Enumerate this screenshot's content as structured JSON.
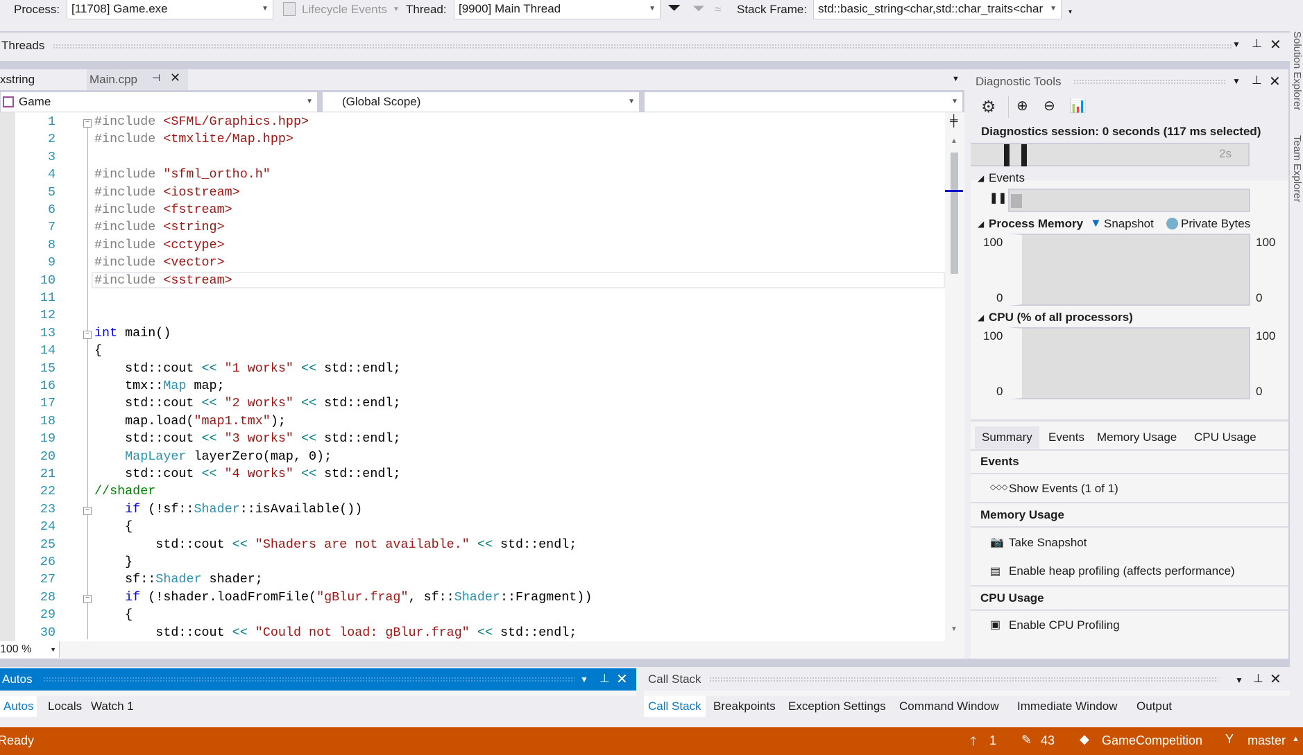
{
  "toolbar": {
    "process_label": "Process:",
    "process_value": "[11708] Game.exe",
    "lifecycle_label": "Lifecycle Events",
    "thread_label": "Thread:",
    "thread_value": "[9900] Main Thread",
    "stack_label": "Stack Frame:",
    "stack_value": "std::basic_string<char,std::char_traits<char"
  },
  "threads": {
    "title": "Threads"
  },
  "editor": {
    "tabs": [
      {
        "label": "xstring"
      },
      {
        "label": "Main.cpp"
      }
    ],
    "nav_project": "Game",
    "nav_scope": "(Global Scope)",
    "nav_member": "",
    "zoom": "100 %",
    "lines": [
      [
        [
          "p",
          "#include "
        ],
        [
          "s",
          "<SFML/Graphics.hpp>"
        ]
      ],
      [
        [
          "p",
          "#include "
        ],
        [
          "s",
          "<tmxlite/Map.hpp>"
        ]
      ],
      [],
      [
        [
          "p",
          "#include "
        ],
        [
          "s",
          "\"sfml_ortho.h\""
        ]
      ],
      [
        [
          "p",
          "#include "
        ],
        [
          "s",
          "<iostream>"
        ]
      ],
      [
        [
          "p",
          "#include "
        ],
        [
          "s",
          "<fstream>"
        ]
      ],
      [
        [
          "p",
          "#include "
        ],
        [
          "s",
          "<string>"
        ]
      ],
      [
        [
          "p",
          "#include "
        ],
        [
          "s",
          "<cctype>"
        ]
      ],
      [
        [
          "p",
          "#include "
        ],
        [
          "s",
          "<vector>"
        ]
      ],
      [
        [
          "p",
          "#include "
        ],
        [
          "s",
          "<sstream>"
        ]
      ],
      [],
      [],
      [
        [
          "k",
          "int"
        ],
        [
          "n",
          " main()"
        ]
      ],
      [
        [
          "n",
          "{"
        ]
      ],
      [
        [
          "n",
          "    std::cout "
        ],
        [
          "o",
          "<<"
        ],
        [
          "n",
          " "
        ],
        [
          "s",
          "\"1 works\""
        ],
        [
          "n",
          " "
        ],
        [
          "o",
          "<<"
        ],
        [
          "n",
          " std::endl;"
        ]
      ],
      [
        [
          "n",
          "    tmx::"
        ],
        [
          "t",
          "Map"
        ],
        [
          "n",
          " map;"
        ]
      ],
      [
        [
          "n",
          "    std::cout "
        ],
        [
          "o",
          "<<"
        ],
        [
          "n",
          " "
        ],
        [
          "s",
          "\"2 works\""
        ],
        [
          "n",
          " "
        ],
        [
          "o",
          "<<"
        ],
        [
          "n",
          " std::endl;"
        ]
      ],
      [
        [
          "n",
          "    map.load("
        ],
        [
          "s",
          "\"map1.tmx\""
        ],
        [
          "n",
          ");"
        ]
      ],
      [
        [
          "n",
          "    std::cout "
        ],
        [
          "o",
          "<<"
        ],
        [
          "n",
          " "
        ],
        [
          "s",
          "\"3 works\""
        ],
        [
          "n",
          " "
        ],
        [
          "o",
          "<<"
        ],
        [
          "n",
          " std::endl;"
        ]
      ],
      [
        [
          "t",
          "    MapLayer"
        ],
        [
          "n",
          " layerZero(map, 0);"
        ]
      ],
      [
        [
          "n",
          "    std::cout "
        ],
        [
          "o",
          "<<"
        ],
        [
          "n",
          " "
        ],
        [
          "s",
          "\"4 works\""
        ],
        [
          "n",
          " "
        ],
        [
          "o",
          "<<"
        ],
        [
          "n",
          " std::endl;"
        ]
      ],
      [
        [
          "c",
          "//shader"
        ]
      ],
      [
        [
          "k",
          "    if"
        ],
        [
          "n",
          " (!sf::"
        ],
        [
          "t",
          "Shader"
        ],
        [
          "n",
          "::isAvailable())"
        ]
      ],
      [
        [
          "n",
          "    {"
        ]
      ],
      [
        [
          "n",
          "        std::cout "
        ],
        [
          "o",
          "<<"
        ],
        [
          "n",
          " "
        ],
        [
          "s",
          "\"Shaders are not available.\""
        ],
        [
          "n",
          " "
        ],
        [
          "o",
          "<<"
        ],
        [
          "n",
          " std::endl;"
        ]
      ],
      [
        [
          "n",
          "    }"
        ]
      ],
      [
        [
          "n",
          "    sf::"
        ],
        [
          "t",
          "Shader"
        ],
        [
          "n",
          " shader;"
        ]
      ],
      [
        [
          "k",
          "    if"
        ],
        [
          "n",
          " (!shader.loadFromFile("
        ],
        [
          "s",
          "\"gBlur.frag\""
        ],
        [
          "n",
          ", sf::"
        ],
        [
          "t",
          "Shader"
        ],
        [
          "n",
          "::Fragment))"
        ]
      ],
      [
        [
          "n",
          "    {"
        ]
      ],
      [
        [
          "n",
          "        std::cout "
        ],
        [
          "o",
          "<<"
        ],
        [
          "n",
          " "
        ],
        [
          "s",
          "\"Could not load: gBlur.frag\""
        ],
        [
          "n",
          " "
        ],
        [
          "o",
          "<<"
        ],
        [
          "n",
          " std::endl;"
        ]
      ]
    ]
  },
  "diag": {
    "title": "Diagnostic Tools",
    "session": "Diagnostics session: 0 seconds (117 ms selected)",
    "timeline_tick": "2s",
    "events_label": "Events",
    "memory_label": "Process Memory",
    "snapshot_legend": "Snapshot",
    "private_legend": "Private Bytes",
    "cpu_label": "CPU (% of all processors)",
    "axis_max": "100",
    "axis_min": "0",
    "tabs": [
      "Summary",
      "Events",
      "Memory Usage",
      "CPU Usage"
    ],
    "sum_events": "Events",
    "show_events": "Show Events (1 of 1)",
    "sum_memory": "Memory Usage",
    "take_snapshot": "Take Snapshot",
    "heap_profiling": "Enable heap profiling (affects performance)",
    "sum_cpu": "CPU Usage",
    "cpu_profiling": "Enable CPU Profiling",
    "colors": {
      "snapshot": "#0e70c0",
      "private_bytes": "#76b0cc"
    }
  },
  "side": {
    "solution": "Solution Explorer",
    "team": "Team Explorer"
  },
  "autos": {
    "title": "Autos",
    "tabs": [
      "Autos",
      "Locals",
      "Watch 1"
    ]
  },
  "callstack": {
    "title": "Call Stack",
    "tabs": [
      "Call Stack",
      "Breakpoints",
      "Exception Settings",
      "Command Window",
      "Immediate Window",
      "Output"
    ]
  },
  "status": {
    "text": "Ready",
    "up": "1",
    "edits": "43",
    "repo": "GameCompetition",
    "branch": "master",
    "color": "#ca5100"
  },
  "accent": "#007acc"
}
